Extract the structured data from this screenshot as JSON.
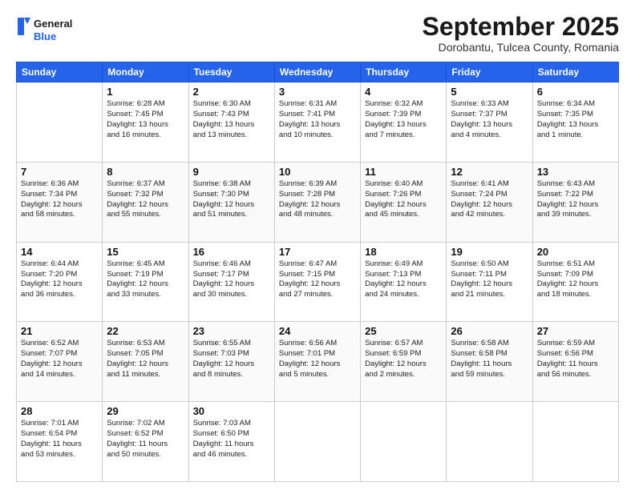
{
  "header": {
    "logo_line1": "General",
    "logo_line2": "Blue",
    "month": "September 2025",
    "location": "Dorobantu, Tulcea County, Romania"
  },
  "days_of_week": [
    "Sunday",
    "Monday",
    "Tuesday",
    "Wednesday",
    "Thursday",
    "Friday",
    "Saturday"
  ],
  "weeks": [
    [
      {
        "day": "",
        "info": ""
      },
      {
        "day": "1",
        "info": "Sunrise: 6:28 AM\nSunset: 7:45 PM\nDaylight: 13 hours\nand 16 minutes."
      },
      {
        "day": "2",
        "info": "Sunrise: 6:30 AM\nSunset: 7:43 PM\nDaylight: 13 hours\nand 13 minutes."
      },
      {
        "day": "3",
        "info": "Sunrise: 6:31 AM\nSunset: 7:41 PM\nDaylight: 13 hours\nand 10 minutes."
      },
      {
        "day": "4",
        "info": "Sunrise: 6:32 AM\nSunset: 7:39 PM\nDaylight: 13 hours\nand 7 minutes."
      },
      {
        "day": "5",
        "info": "Sunrise: 6:33 AM\nSunset: 7:37 PM\nDaylight: 13 hours\nand 4 minutes."
      },
      {
        "day": "6",
        "info": "Sunrise: 6:34 AM\nSunset: 7:35 PM\nDaylight: 13 hours\nand 1 minute."
      }
    ],
    [
      {
        "day": "7",
        "info": "Sunrise: 6:36 AM\nSunset: 7:34 PM\nDaylight: 12 hours\nand 58 minutes."
      },
      {
        "day": "8",
        "info": "Sunrise: 6:37 AM\nSunset: 7:32 PM\nDaylight: 12 hours\nand 55 minutes."
      },
      {
        "day": "9",
        "info": "Sunrise: 6:38 AM\nSunset: 7:30 PM\nDaylight: 12 hours\nand 51 minutes."
      },
      {
        "day": "10",
        "info": "Sunrise: 6:39 AM\nSunset: 7:28 PM\nDaylight: 12 hours\nand 48 minutes."
      },
      {
        "day": "11",
        "info": "Sunrise: 6:40 AM\nSunset: 7:26 PM\nDaylight: 12 hours\nand 45 minutes."
      },
      {
        "day": "12",
        "info": "Sunrise: 6:41 AM\nSunset: 7:24 PM\nDaylight: 12 hours\nand 42 minutes."
      },
      {
        "day": "13",
        "info": "Sunrise: 6:43 AM\nSunset: 7:22 PM\nDaylight: 12 hours\nand 39 minutes."
      }
    ],
    [
      {
        "day": "14",
        "info": "Sunrise: 6:44 AM\nSunset: 7:20 PM\nDaylight: 12 hours\nand 36 minutes."
      },
      {
        "day": "15",
        "info": "Sunrise: 6:45 AM\nSunset: 7:19 PM\nDaylight: 12 hours\nand 33 minutes."
      },
      {
        "day": "16",
        "info": "Sunrise: 6:46 AM\nSunset: 7:17 PM\nDaylight: 12 hours\nand 30 minutes."
      },
      {
        "day": "17",
        "info": "Sunrise: 6:47 AM\nSunset: 7:15 PM\nDaylight: 12 hours\nand 27 minutes."
      },
      {
        "day": "18",
        "info": "Sunrise: 6:49 AM\nSunset: 7:13 PM\nDaylight: 12 hours\nand 24 minutes."
      },
      {
        "day": "19",
        "info": "Sunrise: 6:50 AM\nSunset: 7:11 PM\nDaylight: 12 hours\nand 21 minutes."
      },
      {
        "day": "20",
        "info": "Sunrise: 6:51 AM\nSunset: 7:09 PM\nDaylight: 12 hours\nand 18 minutes."
      }
    ],
    [
      {
        "day": "21",
        "info": "Sunrise: 6:52 AM\nSunset: 7:07 PM\nDaylight: 12 hours\nand 14 minutes."
      },
      {
        "day": "22",
        "info": "Sunrise: 6:53 AM\nSunset: 7:05 PM\nDaylight: 12 hours\nand 11 minutes."
      },
      {
        "day": "23",
        "info": "Sunrise: 6:55 AM\nSunset: 7:03 PM\nDaylight: 12 hours\nand 8 minutes."
      },
      {
        "day": "24",
        "info": "Sunrise: 6:56 AM\nSunset: 7:01 PM\nDaylight: 12 hours\nand 5 minutes."
      },
      {
        "day": "25",
        "info": "Sunrise: 6:57 AM\nSunset: 6:59 PM\nDaylight: 12 hours\nand 2 minutes."
      },
      {
        "day": "26",
        "info": "Sunrise: 6:58 AM\nSunset: 6:58 PM\nDaylight: 11 hours\nand 59 minutes."
      },
      {
        "day": "27",
        "info": "Sunrise: 6:59 AM\nSunset: 6:56 PM\nDaylight: 11 hours\nand 56 minutes."
      }
    ],
    [
      {
        "day": "28",
        "info": "Sunrise: 7:01 AM\nSunset: 6:54 PM\nDaylight: 11 hours\nand 53 minutes."
      },
      {
        "day": "29",
        "info": "Sunrise: 7:02 AM\nSunset: 6:52 PM\nDaylight: 11 hours\nand 50 minutes."
      },
      {
        "day": "30",
        "info": "Sunrise: 7:03 AM\nSunset: 6:50 PM\nDaylight: 11 hours\nand 46 minutes."
      },
      {
        "day": "",
        "info": ""
      },
      {
        "day": "",
        "info": ""
      },
      {
        "day": "",
        "info": ""
      },
      {
        "day": "",
        "info": ""
      }
    ]
  ]
}
